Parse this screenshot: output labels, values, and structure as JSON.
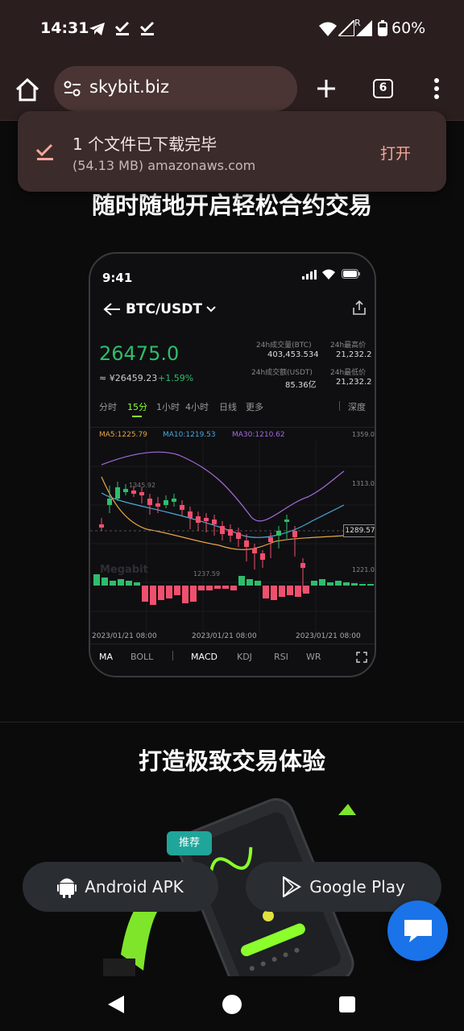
{
  "status_bar": {
    "time": "14:31",
    "battery": "60%",
    "signal_label": "R"
  },
  "browser": {
    "url": "skybit.biz",
    "tab_count": "6"
  },
  "download_toast": {
    "title": "1 个文件已下载完毕",
    "detail": "(54.13 MB) amazonaws.com",
    "action": "打开"
  },
  "page": {
    "section1_title": "随时随地开启轻松合约交易",
    "section2_title": "打造极致交易体验",
    "badge": "推荐",
    "android_button": "Android APK",
    "gplay_button": "Google Play"
  },
  "phone": {
    "time": "9:41",
    "pair": "BTC/USDT",
    "price": "26475.0",
    "cny": "≈ ¥26459.23",
    "change": "+1.59%",
    "stats": [
      {
        "label": "24h成交量(BTC)",
        "value": "403,453.534"
      },
      {
        "label": "24h最高价",
        "value": "21,232.2"
      },
      {
        "label": "24h成交额(USDT)",
        "value": "85.36亿"
      },
      {
        "label": "24h最低价",
        "value": "21,232.2"
      }
    ],
    "timeframes": [
      "分时",
      "15分",
      "1小时",
      "4小时",
      "日线",
      "更多"
    ],
    "depth": "深度",
    "ma5": "MA5:1225.79",
    "ma10": "MA10:1219.53",
    "ma30": "MA30:1210.62",
    "price_axis": [
      "1359.0",
      "1313.0",
      "1221.0"
    ],
    "current_price_tag": "1289.57",
    "hi_label": "1345.92",
    "lo_label": "1237.59",
    "watermark": "Megabit",
    "dates": [
      "2023/01/21 08:00",
      "2023/01/21 08:00",
      "2023/01/21 08:00"
    ],
    "indicators": [
      "MA",
      "BOLL",
      "MACD",
      "KDJ",
      "RSI",
      "WR"
    ]
  },
  "colors": {
    "up": "#2ebd6b",
    "down": "#f0506e",
    "accent": "#8aff2b",
    "chat": "#1a73e8"
  }
}
